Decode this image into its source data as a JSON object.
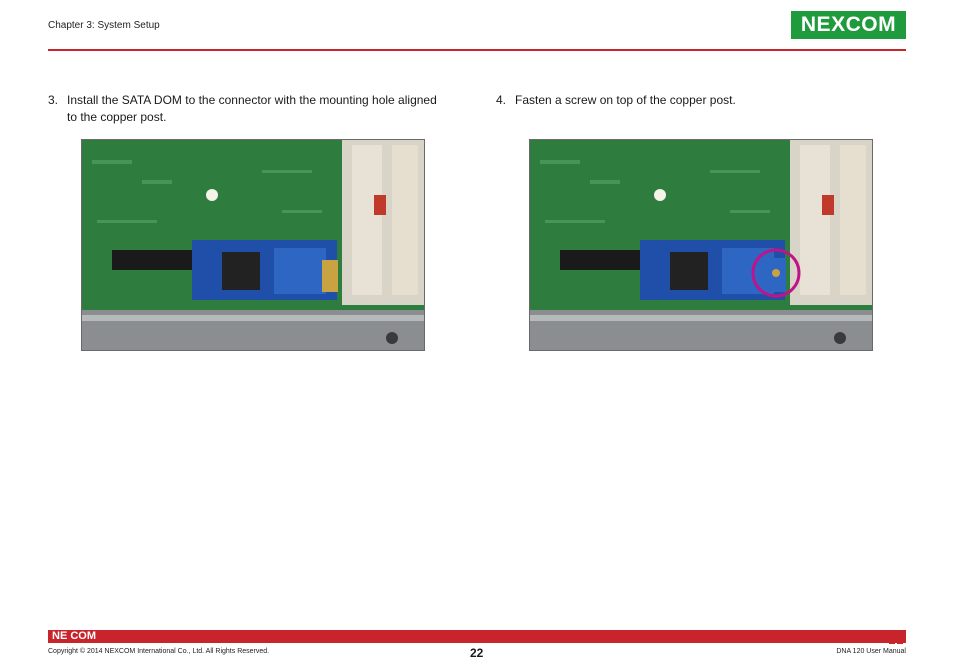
{
  "header": {
    "chapter": "Chapter 3: System Setup",
    "logo": {
      "text_left": "NE",
      "text_x": "X",
      "text_right": "COM",
      "color": "#1f9a3c"
    }
  },
  "steps": [
    {
      "number": "3.",
      "line1": "Install the SATA DOM to the connector with the mounting hole aligned",
      "line2": "to the copper post."
    },
    {
      "number": "4.",
      "line1": "Fasten a screw on top of the copper post."
    }
  ],
  "photos": [
    {
      "subject": "SATA DOM installed on connector",
      "highlight": false
    },
    {
      "subject": "screw fastened on copper post",
      "highlight": true,
      "highlight_color": "#c0138a"
    }
  ],
  "footer": {
    "logo": "NE COM",
    "copyright": "Copyright © 2014 NEXCOM International Co., Ltd. All Rights Reserved.",
    "page": "22",
    "manual": "DNA 120 User Manual",
    "accent": "#c8242b"
  }
}
